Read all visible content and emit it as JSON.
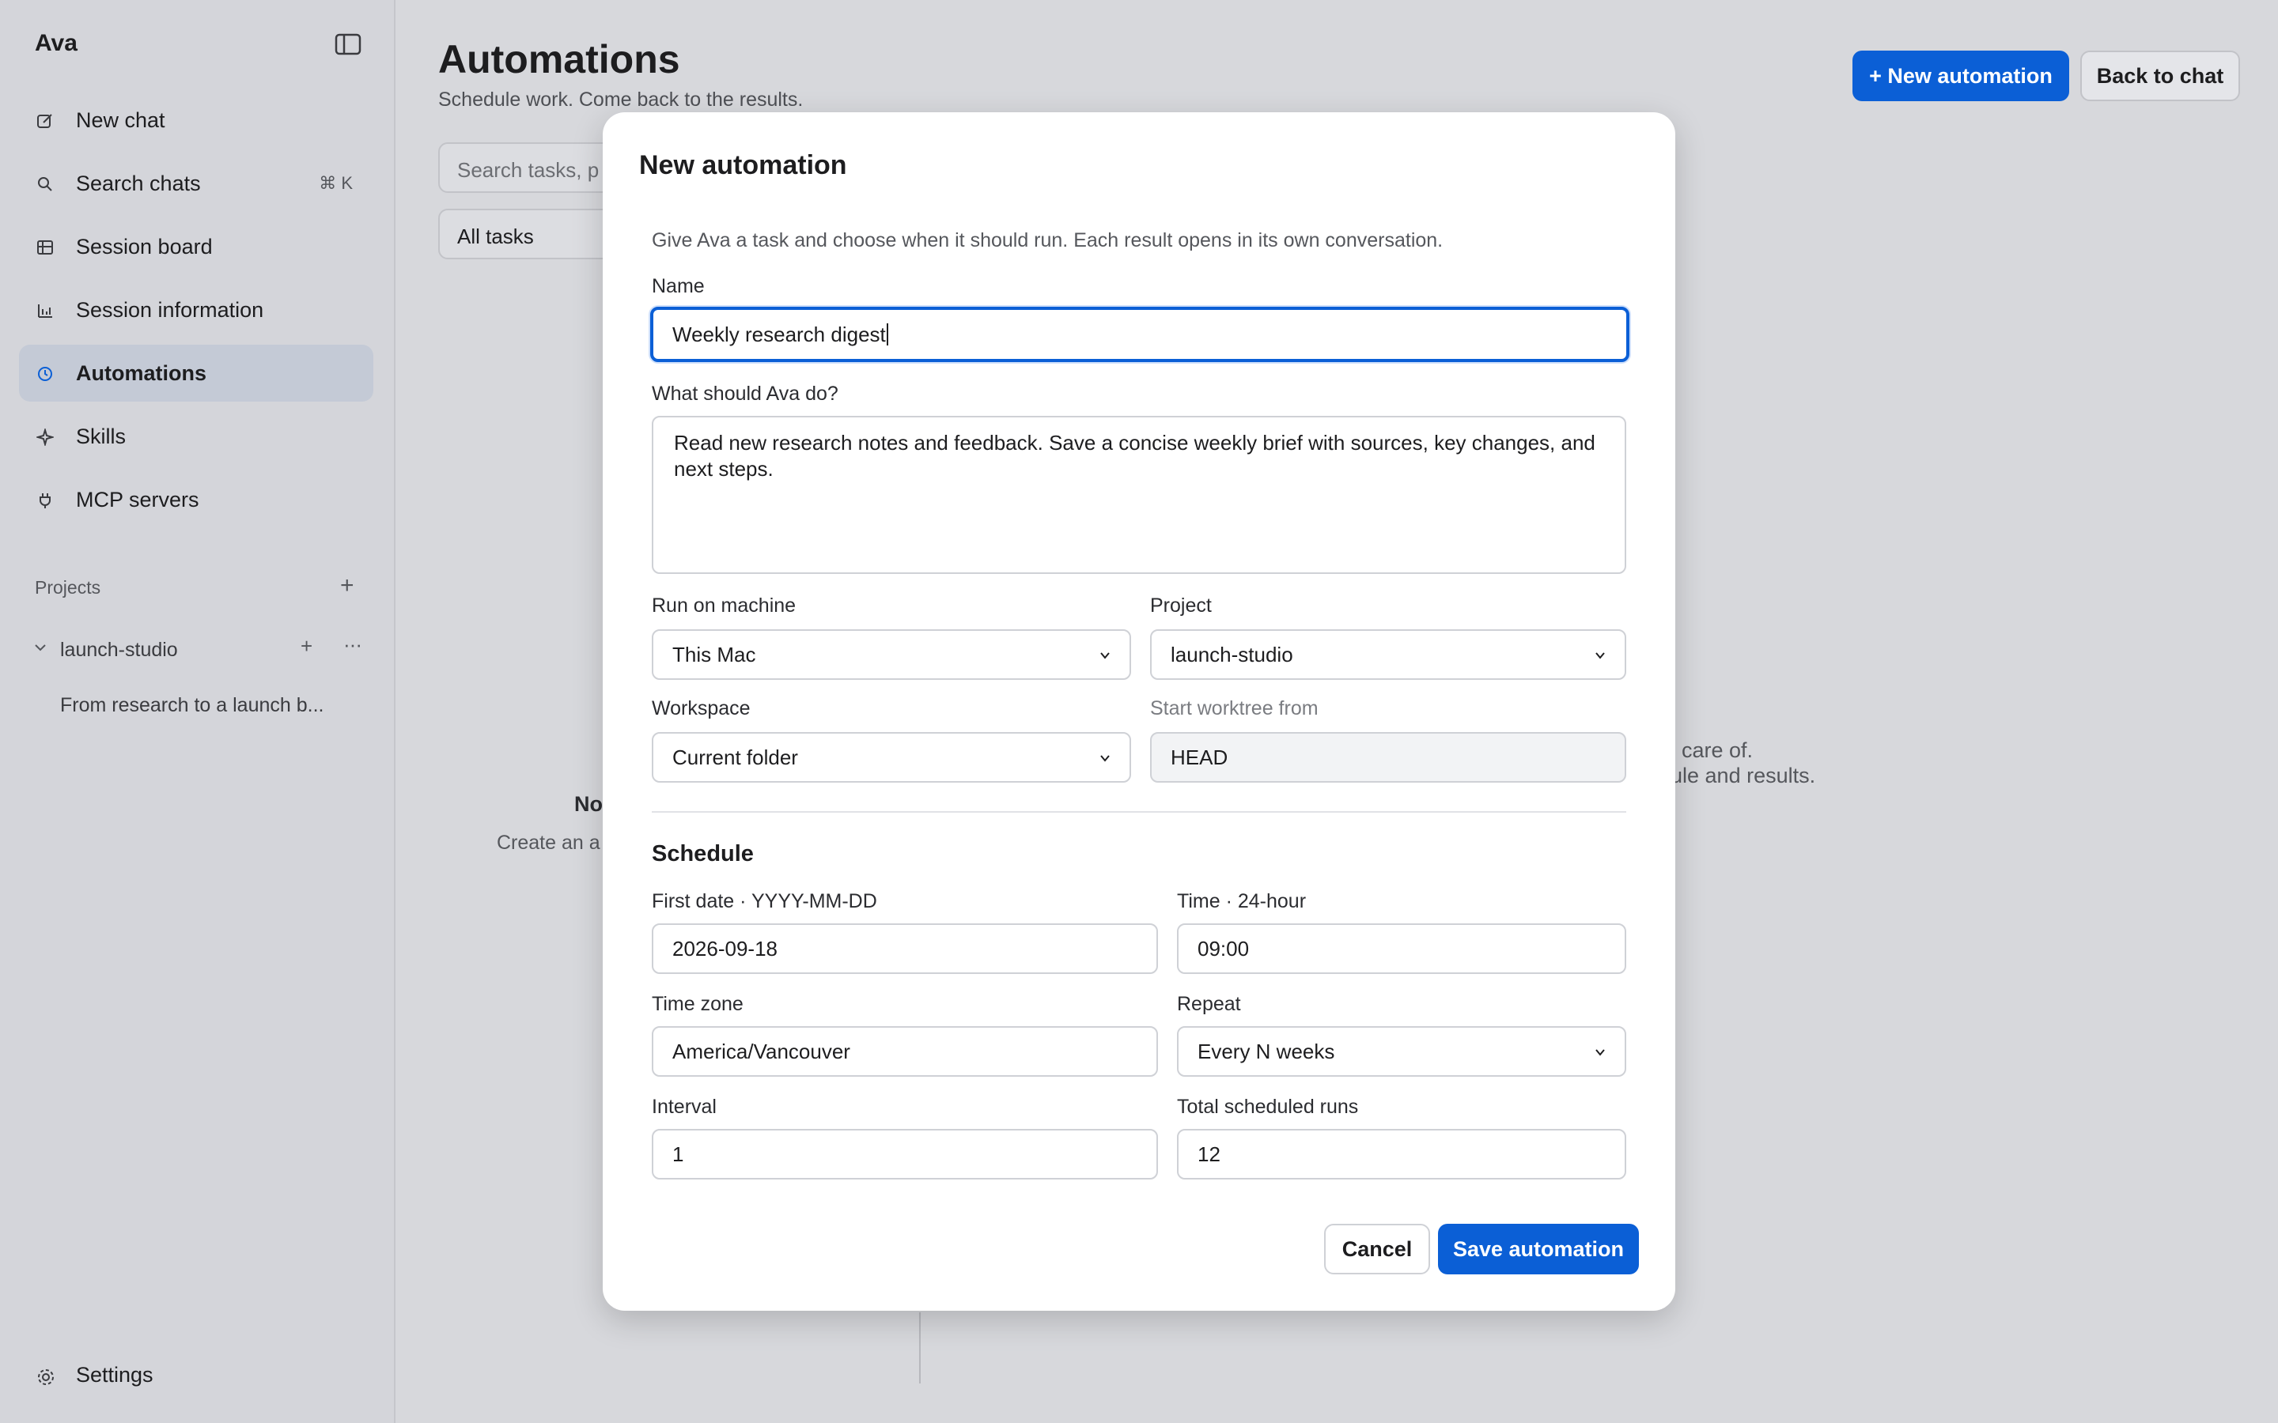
{
  "app": {
    "name": "Ava"
  },
  "sidebar": {
    "items": [
      {
        "label": "New chat",
        "icon": "compose-icon"
      },
      {
        "label": "Search chats",
        "icon": "search-icon",
        "shortcut": "⌘ K"
      },
      {
        "label": "Session board",
        "icon": "board-icon"
      },
      {
        "label": "Session information",
        "icon": "bar-chart-icon"
      },
      {
        "label": "Automations",
        "icon": "clock-icon",
        "active": true
      },
      {
        "label": "Skills",
        "icon": "sparkle-icon"
      },
      {
        "label": "MCP servers",
        "icon": "plug-icon"
      }
    ],
    "projects_label": "Projects",
    "project": {
      "name": "launch-studio",
      "session": "From research to a launch b..."
    },
    "settings_label": "Settings"
  },
  "page": {
    "title": "Automations",
    "subtitle": "Schedule work. Come back to the results.",
    "new_button": "+ New automation",
    "back_button": "Back to chat",
    "search_placeholder": "Search tasks, p",
    "filter_value": "All tasks",
    "empty_title": "No",
    "empty_sub": "Create an a",
    "right_line_1": "care of.",
    "right_line_2": "ule and results."
  },
  "modal": {
    "title": "New automation",
    "description": "Give Ava a task and choose when it should run. Each result opens in its own conversation.",
    "name_label": "Name",
    "name_value": "Weekly research digest",
    "task_label": "What should Ava do?",
    "task_value": "Read new research notes and feedback. Save a concise weekly brief with sources, key changes, and next steps.",
    "machine_label": "Run on machine",
    "machine_value": "This Mac",
    "project_label": "Project",
    "project_value": "launch-studio",
    "workspace_label": "Workspace",
    "workspace_value": "Current folder",
    "worktree_label": "Start worktree from",
    "worktree_value": "HEAD",
    "schedule_title": "Schedule",
    "date_label": "First date · YYYY-MM-DD",
    "date_value": "2026-09-18",
    "time_label": "Time · 24-hour",
    "time_value": "09:00",
    "tz_label": "Time zone",
    "tz_value": "America/Vancouver",
    "repeat_label": "Repeat",
    "repeat_value": "Every N weeks",
    "interval_label": "Interval",
    "interval_value": "1",
    "runs_label": "Total scheduled runs",
    "runs_value": "12",
    "cancel_button": "Cancel",
    "save_button": "Save automation"
  },
  "colors": {
    "accent": "#0b5fd6",
    "sidebar_bg": "#d4d5da",
    "active_item": "#c4cad6"
  }
}
